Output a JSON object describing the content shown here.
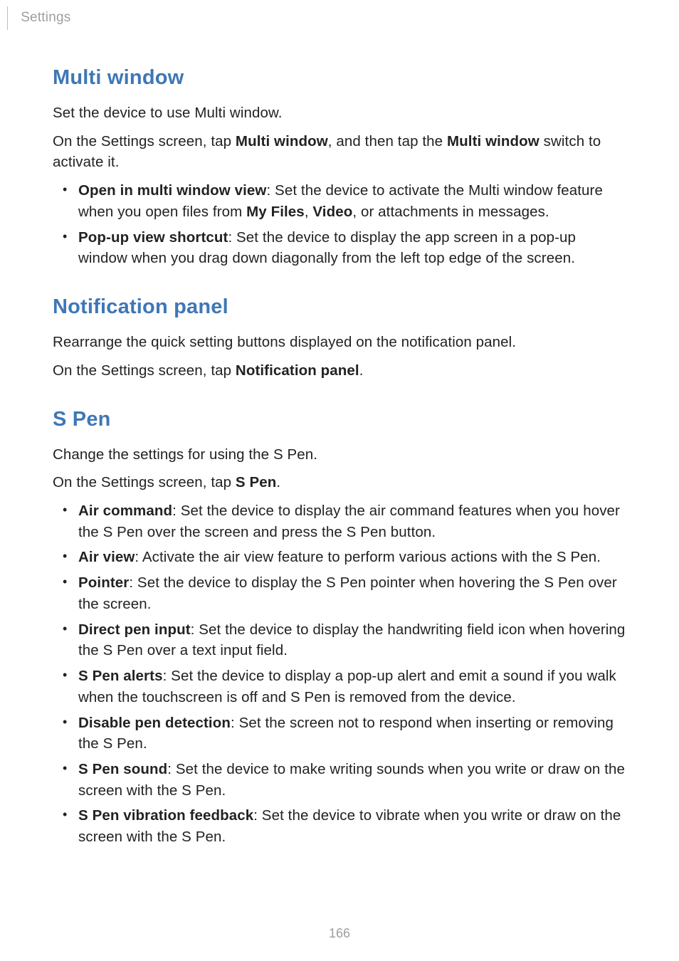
{
  "header": {
    "breadcrumb": "Settings"
  },
  "sections": {
    "multiWindow": {
      "title": "Multi window",
      "p1": "Set the device to use Multi window.",
      "p2_a": "On the Settings screen, tap ",
      "p2_b": "Multi window",
      "p2_c": ", and then tap the ",
      "p2_d": "Multi window",
      "p2_e": " switch to activate it.",
      "b1_bold": "Open in multi window view",
      "b1_rest_a": ": Set the device to activate the Multi window feature when you open files from ",
      "b1_rest_b": "My Files",
      "b1_rest_c": ", ",
      "b1_rest_d": "Video",
      "b1_rest_e": ", or attachments in messages.",
      "b2_bold": "Pop-up view shortcut",
      "b2_rest": ": Set the device to display the app screen in a pop-up window when you drag down diagonally from the left top edge of the screen."
    },
    "notificationPanel": {
      "title": "Notification panel",
      "p1": "Rearrange the quick setting buttons displayed on the notification panel.",
      "p2_a": "On the Settings screen, tap ",
      "p2_b": "Notification panel",
      "p2_c": "."
    },
    "sPen": {
      "title": "S Pen",
      "p1": "Change the settings for using the S Pen.",
      "p2_a": "On the Settings screen, tap ",
      "p2_b": "S Pen",
      "p2_c": ".",
      "b1_bold": "Air command",
      "b1_rest": ": Set the device to display the air command features when you hover the S Pen over the screen and press the S Pen button.",
      "b2_bold": "Air view",
      "b2_rest": ": Activate the air view feature to perform various actions with the S Pen.",
      "b3_bold": "Pointer",
      "b3_rest": ": Set the device to display the S Pen pointer when hovering the S Pen over the screen.",
      "b4_bold": "Direct pen input",
      "b4_rest": ": Set the device to display the handwriting field icon when hovering the S Pen over a text input field.",
      "b5_bold": "S Pen alerts",
      "b5_rest": ": Set the device to display a pop-up alert and emit a sound if you walk when the touchscreen is off and S Pen is removed from the device.",
      "b6_bold": "Disable pen detection",
      "b6_rest": ": Set the screen not to respond when inserting or removing the S Pen.",
      "b7_bold": "S Pen sound",
      "b7_rest": ": Set the device to make writing sounds when you write or draw on the screen with the S Pen.",
      "b8_bold": "S Pen vibration feedback",
      "b8_rest": ": Set the device to vibrate when you write or draw on the screen with the S Pen."
    }
  },
  "pageNumber": "166"
}
